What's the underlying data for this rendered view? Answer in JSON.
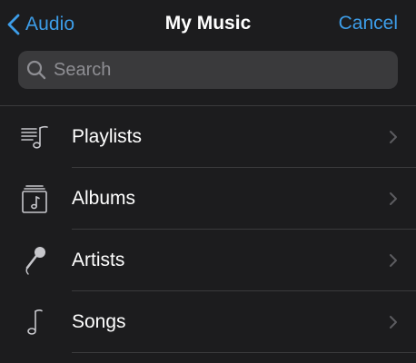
{
  "nav": {
    "back_label": "Audio",
    "title": "My Music",
    "cancel_label": "Cancel",
    "back_icon": "chevron-left-icon"
  },
  "search": {
    "placeholder": "Search",
    "value": "",
    "icon": "magnifying-glass-icon"
  },
  "list": {
    "items": [
      {
        "label": "Playlists",
        "icon": "playlist-icon"
      },
      {
        "label": "Albums",
        "icon": "album-icon"
      },
      {
        "label": "Artists",
        "icon": "microphone-icon"
      },
      {
        "label": "Songs",
        "icon": "music-note-icon"
      }
    ],
    "chevron_icon": "chevron-right-icon"
  },
  "colors": {
    "background": "#1c1c1e",
    "accent": "#3d9de8",
    "search_field": "#3a3a3c",
    "divider": "#3a3a3c",
    "secondary_text": "#8e8e93",
    "icon": "#c7c7cc",
    "chevron": "#5c5c60"
  }
}
